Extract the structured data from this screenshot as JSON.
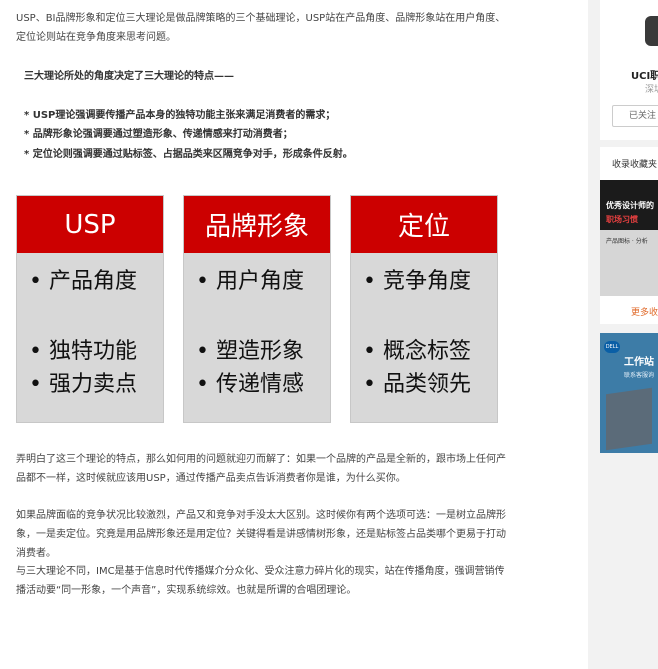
{
  "article": {
    "intro": "USP、BI品牌形象和定位三大理论是做品牌策略的三个基础理论，USP站在产品角度、品牌形象站在用户角度、定位论则站在竞争角度来思考问题。",
    "subhead": "三大理论所处的角度决定了三大理论的特点——",
    "bullets": [
      "* USP理论强调要传播产品本身的独特功能主张来满足消费者的需求；",
      "* 品牌形象论强调要通过塑造形象、传递情感来打动消费者；",
      "* 定位论则强调要通过贴标签、占据品类来区隔竞争对手，形成条件反射。"
    ],
    "para2": "弄明白了这三个理论的特点，那么如何用的问题就迎刃而解了：如果一个品牌的产品是全新的，跟市场上任何产品都不一样，这时候就应该用USP，通过传播产品卖点告诉消费者你是谁，为什么买你。",
    "para3": "如果品牌面临的竞争状况比较激烈，产品又和竞争对手没太大区别。这时候你有两个选项可选：一是树立品牌形象，一是卖定位。究竟是用品牌形象还是用定位？关键得看是讲感情树形象，还是贴标签占品类哪个更易于打动消费者。",
    "para4": "与三大理论不同，IMC是基于信息时代传播媒介分众化、受众注意力碎片化的现实，站在传播角度，强调营销传播活动要“同一形象，一个声音”，实现系统综效。也就是所谓的合唱团理论。"
  },
  "diagram": {
    "accent": "#cc0000",
    "cards": [
      {
        "title": "USP",
        "items": [
          "• 产品角度",
          "• 独特功能",
          "• 强力卖点"
        ]
      },
      {
        "title": "品牌形象",
        "items": [
          "• 用户角度",
          "• 塑造形象",
          "• 传递情感"
        ]
      },
      {
        "title": "定位",
        "items": [
          "• 竞争角度",
          "• 概念标签",
          "• 品类领先"
        ]
      }
    ]
  },
  "sidebar": {
    "user_name": "UCI职",
    "user_sub": "深圳",
    "follow_label": "已关注",
    "collect_title": "收录收藏夹",
    "thumb1_head": "优秀设计师的",
    "thumb1_sub": "职场习惯",
    "thumb1_note": "产品图标 · 分析",
    "more_link": "更多收",
    "thumb2_logo": "DELL",
    "thumb2_title": "工作站",
    "thumb2_sub": "联系客服询"
  }
}
